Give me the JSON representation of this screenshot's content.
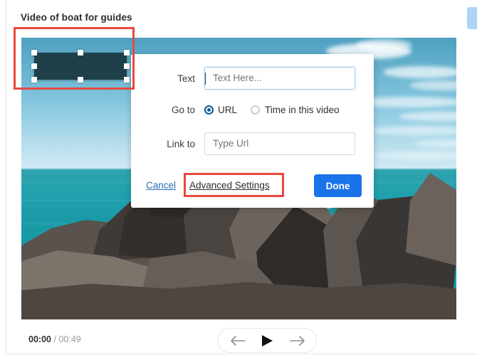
{
  "page": {
    "title": "Video of boat for guides"
  },
  "video": {
    "hotspot_name": "hotspot-overlay"
  },
  "dialog": {
    "fields": {
      "text": {
        "label": "Text",
        "placeholder": "Text Here...",
        "value": ""
      },
      "link_to": {
        "label": "Link to",
        "placeholder": "Type Url",
        "value": ""
      }
    },
    "goto": {
      "label": "Go to",
      "options": [
        {
          "label": "URL",
          "selected": true
        },
        {
          "label": "Time in this video",
          "selected": false
        }
      ]
    },
    "footer": {
      "cancel_label": "Cancel",
      "advanced_label": "Advanced Settings",
      "done_label": "Done"
    }
  },
  "playback": {
    "current_time": "00:00",
    "separator": "/",
    "total_time": "00:49",
    "prev_icon": "arrow-left-icon",
    "play_icon": "play-icon",
    "next_icon": "arrow-right-icon"
  },
  "annotations": {
    "hotspot_highlight_color": "#e8483f",
    "advanced_highlight_color": "#e8483f"
  },
  "colors": {
    "done_button": "#1a73e8",
    "radio_selected": "#0f5d9e",
    "cancel_link": "#2a6eb5",
    "chip": "#aed3f4"
  }
}
